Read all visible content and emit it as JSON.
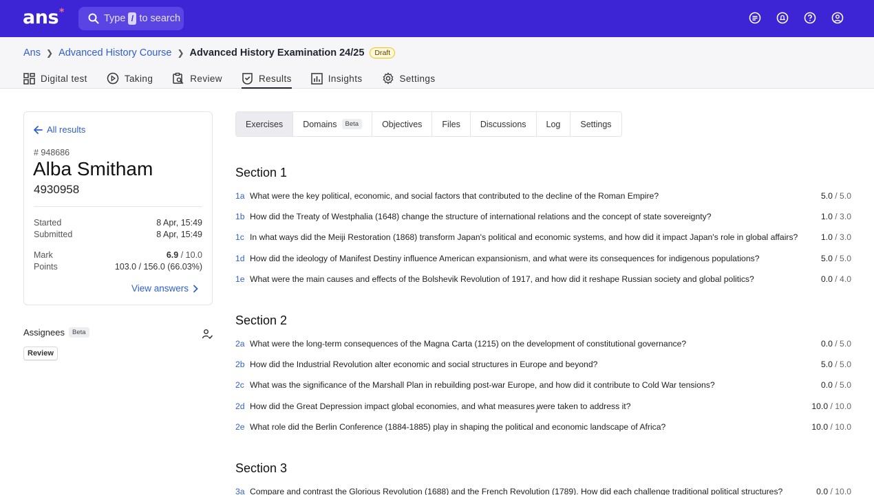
{
  "topbar": {
    "logo": "ans",
    "logo_mark": "*",
    "search_before": "Type",
    "search_key": "/",
    "search_after": "to search",
    "icons": [
      "switch-icon",
      "bell-icon",
      "help-icon",
      "user-icon"
    ],
    "bg_color": "#3d25d6"
  },
  "breadcrumb": {
    "items": [
      "Ans",
      "Advanced History Course"
    ],
    "current": "Advanced History Examination 24/25",
    "badge": "Draft"
  },
  "nav": {
    "tabs": [
      {
        "label": "Digital test",
        "icon": "grid-icon"
      },
      {
        "label": "Taking",
        "icon": "play-icon"
      },
      {
        "label": "Review",
        "icon": "review-icon"
      },
      {
        "label": "Results",
        "icon": "check-shield-icon"
      },
      {
        "label": "Insights",
        "icon": "chart-icon"
      },
      {
        "label": "Settings",
        "icon": "gear-icon"
      }
    ],
    "active": "Results"
  },
  "candidate": {
    "back_label": "All results",
    "id": "# 948686",
    "name": "Alba Smitham",
    "number": "4930958",
    "started_label": "Started",
    "started": "8 Apr, 15:49",
    "submitted_label": "Submitted",
    "submitted": "8 Apr, 15:49",
    "mark_label": "Mark",
    "mark": "6.9",
    "mark_max": " / 10.0",
    "points_label": "Points",
    "points": "103.0 / 156.0 (66.03%)",
    "view_answers": "View answers"
  },
  "assignees": {
    "title": "Assignees",
    "beta": "Beta",
    "chip": "Review"
  },
  "subtabs": {
    "items": [
      {
        "label": "Exercises"
      },
      {
        "label": "Domains",
        "badge": "Beta"
      },
      {
        "label": "Objectives"
      },
      {
        "label": "Files"
      },
      {
        "label": "Discussions"
      },
      {
        "label": "Log"
      },
      {
        "label": "Settings"
      }
    ],
    "active": "Exercises"
  },
  "sections": [
    {
      "title": "Section 1",
      "questions": [
        {
          "code": "1a",
          "text": "What were the key political, economic, and social factors that contributed to the decline of the Roman Empire?",
          "score": "5.0",
          "max": " / 5.0"
        },
        {
          "code": "1b",
          "text": "How did the Treaty of Westphalia (1648) change the structure of international relations and the concept of state sovereignty?",
          "score": "1.0",
          "max": " / 3.0"
        },
        {
          "code": "1c",
          "text": "In what ways did the Meiji Restoration (1868) transform Japan's political and economic systems, and how did it impact Japan's role in global affairs?",
          "score": "1.0",
          "max": " / 3.0"
        },
        {
          "code": "1d",
          "text": "How did the ideology of Manifest Destiny influence American expansionism, and what were its consequences for indigenous populations?",
          "score": "5.0",
          "max": " / 5.0"
        },
        {
          "code": "1e",
          "text": "What were the main causes and effects of the Bolshevik Revolution of 1917, and how did it reshape Russian society and global politics?",
          "score": "0.0",
          "max": " / 4.0"
        }
      ]
    },
    {
      "title": "Section 2",
      "questions": [
        {
          "code": "2a",
          "text": "What were the long-term consequences of the Magna Carta (1215) on the development of constitutional governance?",
          "score": "0.0",
          "max": " / 5.0"
        },
        {
          "code": "2b",
          "text": "How did the Industrial Revolution alter economic and social structures in Europe and beyond?",
          "score": "5.0",
          "max": " / 5.0"
        },
        {
          "code": "2c",
          "text": "What was the significance of the Marshall Plan in rebuilding post-war Europe, and how did it contribute to Cold War tensions?",
          "score": "0.0",
          "max": " / 5.0"
        },
        {
          "code": "2d",
          "text": "How did the Great Depression impact global economies, and what measures were taken to address it?",
          "score": "10.0",
          "max": " / 10.0"
        },
        {
          "code": "2e",
          "text": "What role did the Berlin Conference (1884-1885) play in shaping the political and economic landscape of Africa?",
          "score": "10.0",
          "max": " / 10.0"
        }
      ]
    },
    {
      "title": "Section 3",
      "questions": [
        {
          "code": "3a",
          "text": "Compare and contrast the Glorious Revolution (1688) and the French Revolution (1789). How did each challenge traditional political structures?",
          "score": "0.0",
          "max": " / 10.0"
        }
      ]
    }
  ]
}
